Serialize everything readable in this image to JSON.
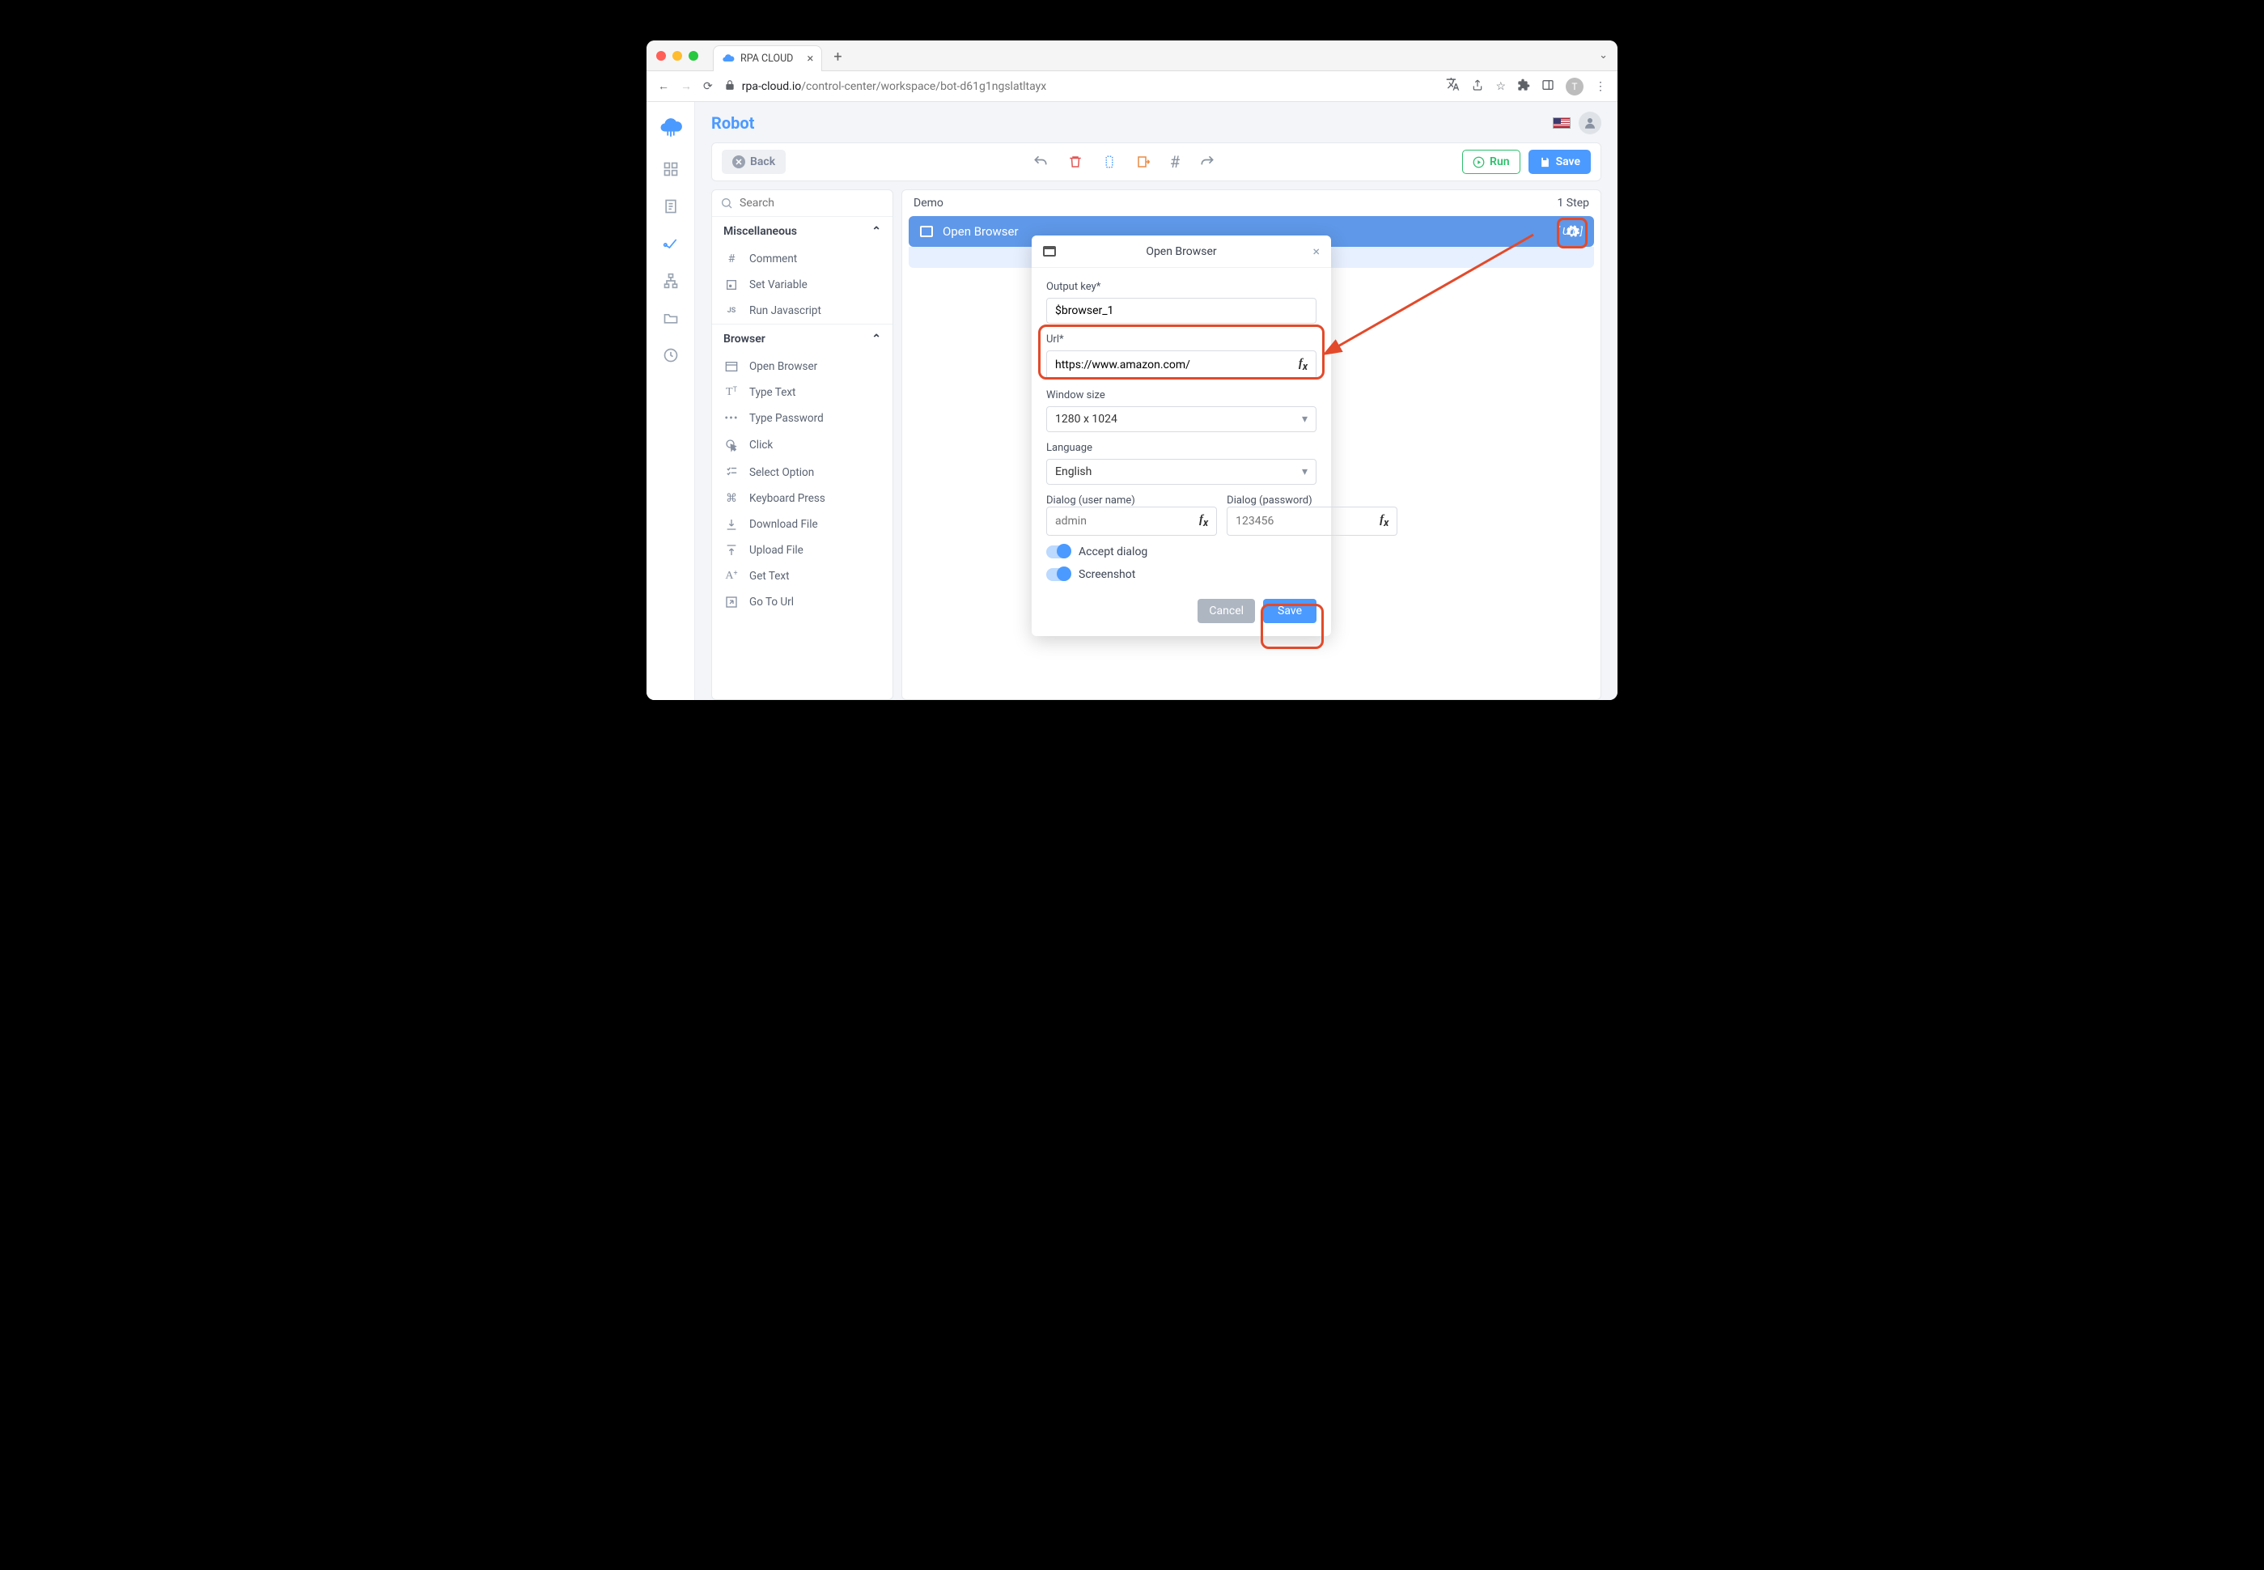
{
  "browser": {
    "tab_title": "RPA CLOUD",
    "url_host": "rpa-cloud.io",
    "url_path": "/control-center/workspace/bot-d61g1ngslatltayx",
    "avatar_letter": "T"
  },
  "page": {
    "title": "Robot"
  },
  "toolbar": {
    "back": "Back",
    "run": "Run",
    "save": "Save"
  },
  "search": {
    "placeholder": "Search"
  },
  "categories": {
    "misc": {
      "title": "Miscellaneous",
      "items": [
        "Comment",
        "Set Variable",
        "Run Javascript"
      ]
    },
    "browser": {
      "title": "Browser",
      "items": [
        "Open Browser",
        "Type Text",
        "Type Password",
        "Click",
        "Select Option",
        "Keyboard Press",
        "Download File",
        "Upload File",
        "Get Text",
        "Go To Url"
      ]
    }
  },
  "canvas": {
    "flow_name": "Demo",
    "step_count": "1 Step",
    "step_title": "Open Browser",
    "step_badge": "[ Url: ]"
  },
  "popup": {
    "title": "Open Browser",
    "output_key_label": "Output key*",
    "output_key_value": "$browser_1",
    "url_label": "Url*",
    "url_value": "https://www.amazon.com/",
    "window_size_label": "Window size",
    "window_size_value": "1280 x 1024",
    "language_label": "Language",
    "language_value": "English",
    "dialog_user_label": "Dialog (user name)",
    "dialog_user_placeholder": "admin",
    "dialog_pass_label": "Dialog (password)",
    "dialog_pass_placeholder": "123456",
    "toggle_accept": "Accept dialog",
    "toggle_screenshot": "Screenshot",
    "cancel": "Cancel",
    "save": "Save"
  }
}
